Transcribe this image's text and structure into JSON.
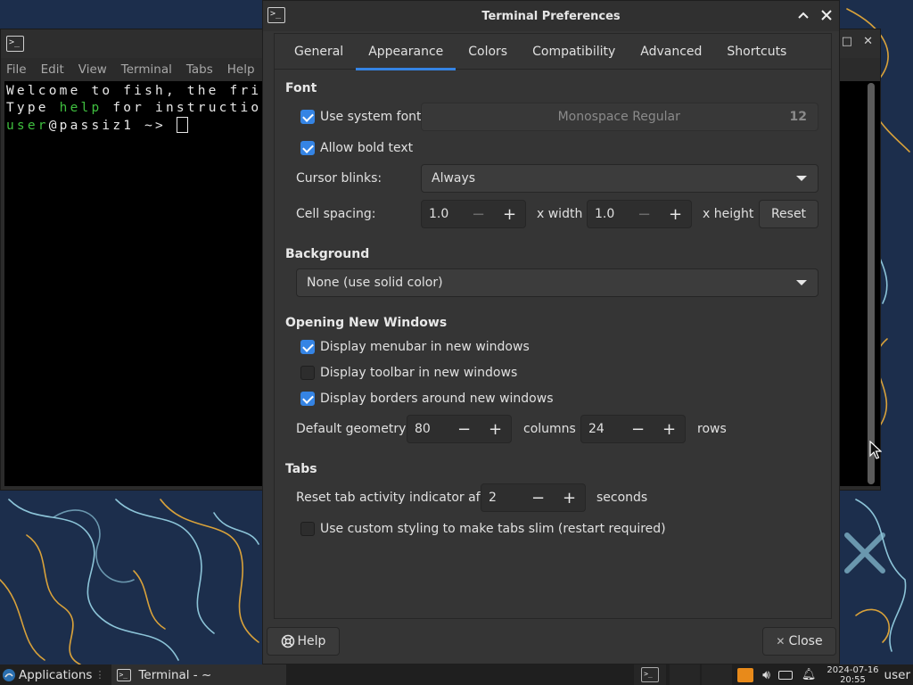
{
  "terminal": {
    "menu": [
      "File",
      "Edit",
      "View",
      "Terminal",
      "Tabs",
      "Help"
    ],
    "lines": {
      "line1": "Welcome to fish, the fri",
      "line2_a": "Type ",
      "line2_b": "help",
      "line2_c": " for instructio",
      "prompt_user": "user",
      "prompt_host": "@passiz1",
      "prompt_tail": " ~> "
    }
  },
  "dialog": {
    "title": "Terminal Preferences",
    "tabs": [
      "General",
      "Appearance",
      "Colors",
      "Compatibility",
      "Advanced",
      "Shortcuts"
    ],
    "active_tab": "Appearance",
    "font": {
      "section": "Font",
      "use_system_font": {
        "label": "Use system font",
        "checked": true
      },
      "font_name": "Monospace Regular",
      "font_size": "12",
      "allow_bold": {
        "label": "Allow bold text",
        "checked": true
      },
      "cursor_blinks_label": "Cursor blinks:",
      "cursor_blinks_value": "Always",
      "cell_spacing_label": "Cell spacing:",
      "cell_width_value": "1.0",
      "x_width_label": "x width",
      "cell_height_value": "1.0",
      "x_height_label": "x height",
      "reset_label": "Reset"
    },
    "background": {
      "section": "Background",
      "value": "None (use solid color)"
    },
    "opening": {
      "section": "Opening New Windows",
      "menubar": {
        "label": "Display menubar in new windows",
        "checked": true
      },
      "toolbar": {
        "label": "Display toolbar in new windows",
        "checked": false
      },
      "borders": {
        "label": "Display borders around new windows",
        "checked": true
      },
      "geometry_label": "Default geometry",
      "columns_value": "80",
      "columns_label": "columns",
      "rows_value": "24",
      "rows_label": "rows"
    },
    "tabs_section": {
      "section": "Tabs",
      "reset_label": "Reset tab activity indicator after",
      "reset_value": "2",
      "seconds_label": "seconds",
      "slim": {
        "label": "Use custom styling to make tabs slim (restart required)",
        "checked": false
      }
    },
    "help_label": "Help",
    "close_label": "Close"
  },
  "taskbar": {
    "applications": "Applications",
    "task": "Terminal - ~",
    "date": "2024-07-16",
    "time": "20:55",
    "user": "user"
  },
  "colors": {
    "accent": "#3584e4",
    "terminal_green": "#3fbf3f",
    "wallpaper": "#1c2e4c"
  }
}
